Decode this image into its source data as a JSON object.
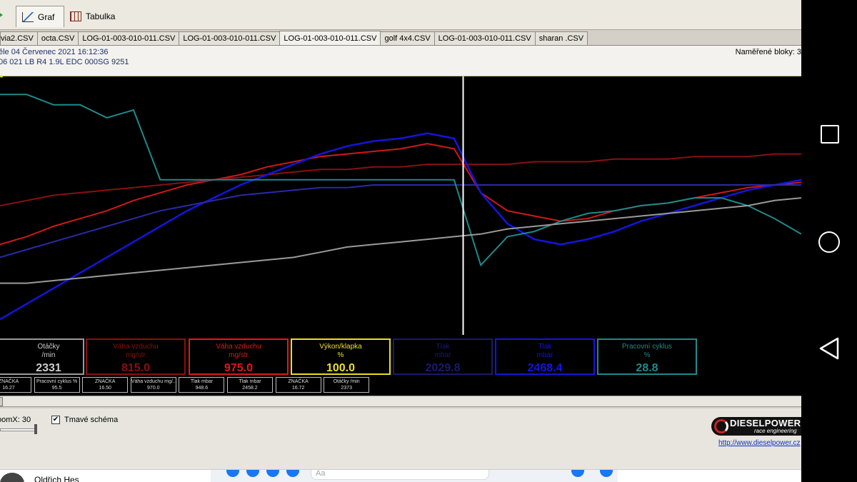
{
  "toolbar": {
    "graf_label": "Graf",
    "tabulka_label": "Tabulka"
  },
  "tabs": [
    {
      "label": "via2.CSV",
      "active": false
    },
    {
      "label": "octa.CSV",
      "active": false
    },
    {
      "label": "LOG-01-003-010-011.CSV",
      "active": false
    },
    {
      "label": "LOG-01-003-010-011.CSV",
      "active": false
    },
    {
      "label": "LOG-01-003-010-011.CSV",
      "active": true
    },
    {
      "label": "golf 4x4.CSV",
      "active": false
    },
    {
      "label": "LOG-01-003-010-011.CSV",
      "active": false
    },
    {
      "label": "sharan .CSV",
      "active": false
    }
  ],
  "info": {
    "date": "ěle 04 Červenec 2021 16:12:36",
    "engine": "06 021 LB  R4 1.9L EDC  000SG  9251",
    "blocks": "Naměřené bloky: 3"
  },
  "chart_data": {
    "type": "line",
    "cursor_x": 0.578,
    "series": [
      {
        "color": "#d01818",
        "values": [
          0.35,
          0.38,
          0.42,
          0.45,
          0.48,
          0.52,
          0.55,
          0.58,
          0.6,
          0.62,
          0.65,
          0.67,
          0.69,
          0.7,
          0.71,
          0.72,
          0.74,
          0.72,
          0.55,
          0.48,
          0.46,
          0.44,
          0.45,
          0.48,
          0.5,
          0.51,
          0.53,
          0.55,
          0.57,
          0.58,
          0.59
        ]
      },
      {
        "color": "#8a1010",
        "values": [
          0.5,
          0.52,
          0.54,
          0.55,
          0.56,
          0.57,
          0.58,
          0.59,
          0.6,
          0.61,
          0.62,
          0.63,
          0.64,
          0.64,
          0.65,
          0.65,
          0.66,
          0.66,
          0.66,
          0.66,
          0.67,
          0.67,
          0.67,
          0.68,
          0.68,
          0.68,
          0.69,
          0.69,
          0.69,
          0.7,
          0.7
        ]
      },
      {
        "color": "#1414e0",
        "values": [
          0.06,
          0.12,
          0.18,
          0.24,
          0.3,
          0.36,
          0.42,
          0.48,
          0.53,
          0.58,
          0.62,
          0.66,
          0.7,
          0.73,
          0.75,
          0.76,
          0.78,
          0.76,
          0.55,
          0.43,
          0.37,
          0.35,
          0.37,
          0.4,
          0.44,
          0.47,
          0.5,
          0.53,
          0.56,
          0.58,
          0.6
        ]
      },
      {
        "color": "#2a2aa8",
        "values": [
          0.3,
          0.33,
          0.36,
          0.39,
          0.42,
          0.45,
          0.48,
          0.5,
          0.52,
          0.54,
          0.55,
          0.56,
          0.57,
          0.57,
          0.58,
          0.58,
          0.58,
          0.58,
          0.58,
          0.58,
          0.58,
          0.58,
          0.58,
          0.58,
          0.58,
          0.58,
          0.58,
          0.58,
          0.58,
          0.58,
          0.58
        ]
      },
      {
        "color": "#1e8a8a",
        "values": [
          0.93,
          0.93,
          0.89,
          0.89,
          0.84,
          0.87,
          0.6,
          0.6,
          0.6,
          0.6,
          0.6,
          0.6,
          0.6,
          0.6,
          0.6,
          0.6,
          0.6,
          0.6,
          0.27,
          0.38,
          0.4,
          0.44,
          0.47,
          0.48,
          0.5,
          0.51,
          0.53,
          0.53,
          0.5,
          0.45,
          0.39
        ]
      },
      {
        "color": "#9a9a9a",
        "values": [
          0.2,
          0.2,
          0.21,
          0.22,
          0.23,
          0.24,
          0.25,
          0.26,
          0.27,
          0.28,
          0.29,
          0.3,
          0.32,
          0.34,
          0.35,
          0.36,
          0.37,
          0.38,
          0.39,
          0.41,
          0.42,
          0.43,
          0.44,
          0.45,
          0.46,
          0.47,
          0.48,
          0.49,
          0.5,
          0.52,
          0.53
        ]
      },
      {
        "color": "#e8e020",
        "values": [
          1.0,
          0.98,
          1.0
        ]
      }
    ]
  },
  "gauges": [
    {
      "title": "Otáčky",
      "unit": "/min",
      "value": "2331",
      "color": "#9a9a9a"
    },
    {
      "title": "Váha vzduchu",
      "unit": "mg/str",
      "value": "815.0",
      "color": "#8a1010"
    },
    {
      "title": "Váha vzduchu",
      "unit": "mg/str",
      "value": "975.0",
      "color": "#e01818"
    },
    {
      "title": "Výkon/klapka",
      "unit": "%",
      "value": "100.0",
      "color": "#e8e020"
    },
    {
      "title": "Tlak",
      "unit": "mbar",
      "value": "2029.8",
      "color": "#1a1a70"
    },
    {
      "title": "Tlak",
      "unit": "mbar",
      "value": "2468.4",
      "color": "#1414e0"
    },
    {
      "title": "Pracovní cyklus",
      "unit": "%",
      "value": "28.8",
      "color": "#1e8a8a"
    }
  ],
  "mini": [
    {
      "l1": "ZNAČKA",
      "l2": "16.27"
    },
    {
      "l1": "Pracovní cyklus %",
      "l2": "95.5"
    },
    {
      "l1": "ZNAČKA",
      "l2": "16.50"
    },
    {
      "l1": "Váha vzduchu mg/...",
      "l2": "970.0"
    },
    {
      "l1": "Tlak mbar",
      "l2": "948.6"
    },
    {
      "l1": "Tlak mbar",
      "l2": "2458.2"
    },
    {
      "l1": "ZNAČKA",
      "l2": "16.72"
    },
    {
      "l1": "Otáčky /min",
      "l2": "2373"
    }
  ],
  "bottom": {
    "zoom_label": "oomX: 30",
    "dark_scheme_label": "Tmavé schéma",
    "dark_scheme_checked": "✔",
    "logo_text": "DIESELPOWER",
    "logo_sub": "race engineering",
    "site_url": "http://www.dieselpower.cz"
  },
  "taskbar": {
    "user_name": "Oldřich Hes",
    "search_placeholder": "Aa"
  }
}
